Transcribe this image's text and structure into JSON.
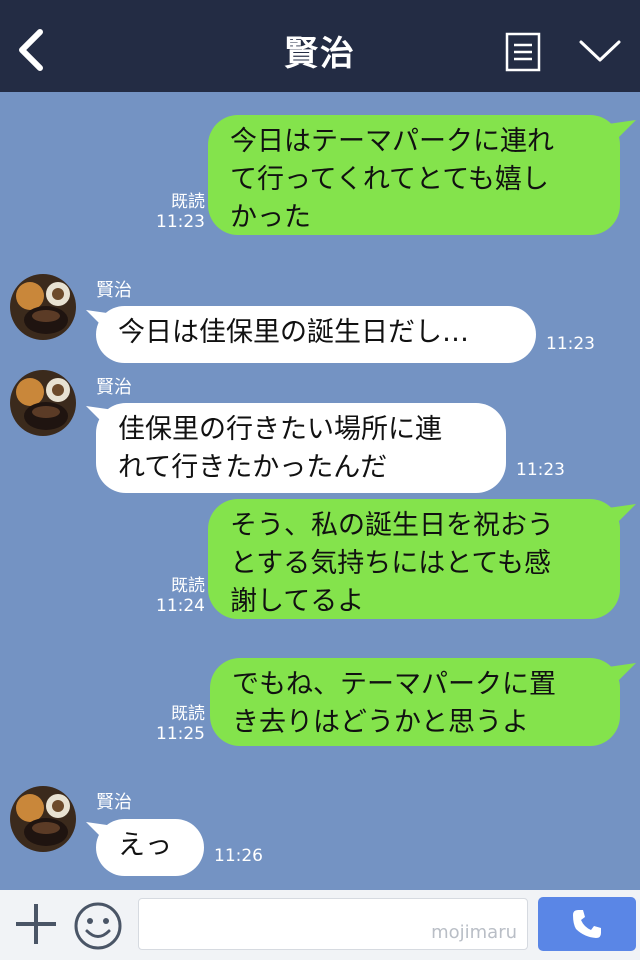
{
  "header": {
    "title": "賢治"
  },
  "messages": [
    {
      "text": "今日はテーマパークに連れ\nて行ってくれてとても嬉し\nかった",
      "read": "既読",
      "time": "11:23"
    },
    {
      "sender": "賢治",
      "text": "今日は佳保里の誕生日だし…",
      "time": "11:23"
    },
    {
      "sender": "賢治",
      "text": "佳保里の行きたい場所に連\nれて行きたかったんだ",
      "time": "11:23"
    },
    {
      "text": "そう、私の誕生日を祝おう\nとする気持ちにはとても感\n謝してるよ",
      "read": "既読",
      "time": "11:24"
    },
    {
      "text": "でもね、テーマパークに置\nき去りはどうかと思うよ",
      "read": "既読",
      "time": "11:25"
    },
    {
      "sender": "賢治",
      "text": "えっ",
      "time": "11:26"
    }
  ],
  "input": {
    "watermark": "mojimaru"
  },
  "colors": {
    "header_bg": "#232c44",
    "chat_bg": "#7493c3",
    "outgoing_bubble": "#84e34c",
    "incoming_bubble": "#ffffff",
    "call_button": "#5a86e6"
  },
  "icons": [
    "back-icon",
    "menu-icon",
    "chevron-down-icon",
    "plus-icon",
    "smile-icon",
    "phone-icon"
  ]
}
